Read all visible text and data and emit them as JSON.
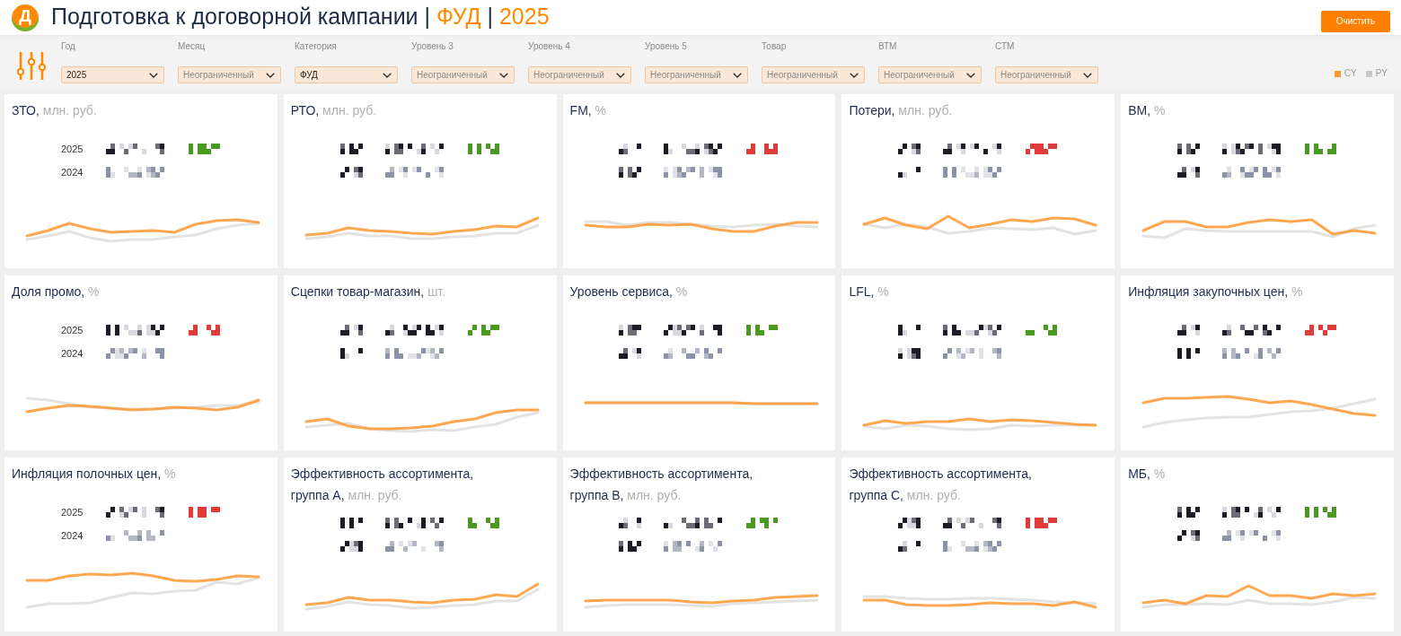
{
  "header": {
    "logo_letter": "Д",
    "title": {
      "text": "Подготовка к договорной кампании",
      "separators": [
        "|",
        "|"
      ],
      "category": "ФУД",
      "year": "2025"
    },
    "clear_button": "Очистить"
  },
  "filters": [
    {
      "label": "Год",
      "value": "2025"
    },
    {
      "label": "Месяц",
      "placeholder": "Неограниченный"
    },
    {
      "label": "Категория",
      "value": "ФУД"
    },
    {
      "label": "Уровень 3",
      "placeholder": "Неограниченный"
    },
    {
      "label": "Уровень 4",
      "placeholder": "Неограниченный"
    },
    {
      "label": "Уровень 5",
      "placeholder": "Неограниченный"
    },
    {
      "label": "Товар",
      "placeholder": "Неограниченный"
    },
    {
      "label": "ВТМ",
      "placeholder": "Неограниченный"
    },
    {
      "label": "СТМ",
      "placeholder": "Неограниченный"
    }
  ],
  "legend": [
    {
      "label": "CY",
      "color": "#ff9933"
    },
    {
      "label": "PY",
      "color": "#c8c8c8"
    }
  ],
  "cards": [
    {
      "title": "ЗТО,",
      "unit": "млн. руб.",
      "years": [
        "2025",
        "2024"
      ],
      "delta": {
        "color": "#4a9a22"
      }
    },
    {
      "title": "РТО,",
      "unit": "млн. руб.",
      "delta": {
        "color": "#4a9a22"
      }
    },
    {
      "title": "FM,",
      "unit": "%",
      "delta": {
        "color": "#e03a3a"
      }
    },
    {
      "title": "Потери,",
      "unit": "млн. руб.",
      "delta": {
        "color": "#e03a3a"
      }
    },
    {
      "title": "ВМ,",
      "unit": "%",
      "delta": {
        "color": "#4a9a22"
      }
    },
    {
      "title": "Доля промо,",
      "unit": "%",
      "years": [
        "2025",
        "2024"
      ],
      "delta": {
        "color": "#e03a3a"
      }
    },
    {
      "title": "Сцепки товар-магазин,",
      "unit": "шт.",
      "delta": {
        "color": "#4a9a22"
      }
    },
    {
      "title": "Уровень сервиса,",
      "unit": "%",
      "delta": {
        "color": "#4a9a22"
      }
    },
    {
      "title": "LFL,",
      "unit": "%",
      "delta": {
        "color": "#4a9a22"
      }
    },
    {
      "title": "Инфляция закупочных цен,",
      "unit": "%",
      "delta": {
        "color": "#e03a3a"
      }
    },
    {
      "title": "Инфляция полочных цен,",
      "unit": "%",
      "years": [
        "2025",
        "2024"
      ],
      "delta": {
        "color": "#e03a3a"
      }
    },
    {
      "title": "Эффективность ассортимента, группа А,",
      "unit": "млн. руб.",
      "delta": {
        "color": "#4a9a22"
      }
    },
    {
      "title": "Эффективность ассортимента, группа В,",
      "unit": "млн. руб.",
      "delta": {
        "color": "#4a9a22"
      }
    },
    {
      "title": "Эффективность ассортимента, группа С,",
      "unit": "млн. руб.",
      "delta": {
        "color": "#e03a3a"
      }
    },
    {
      "title": "МБ,",
      "unit": "%",
      "delta": {
        "color": "#4a9a22"
      }
    }
  ]
}
